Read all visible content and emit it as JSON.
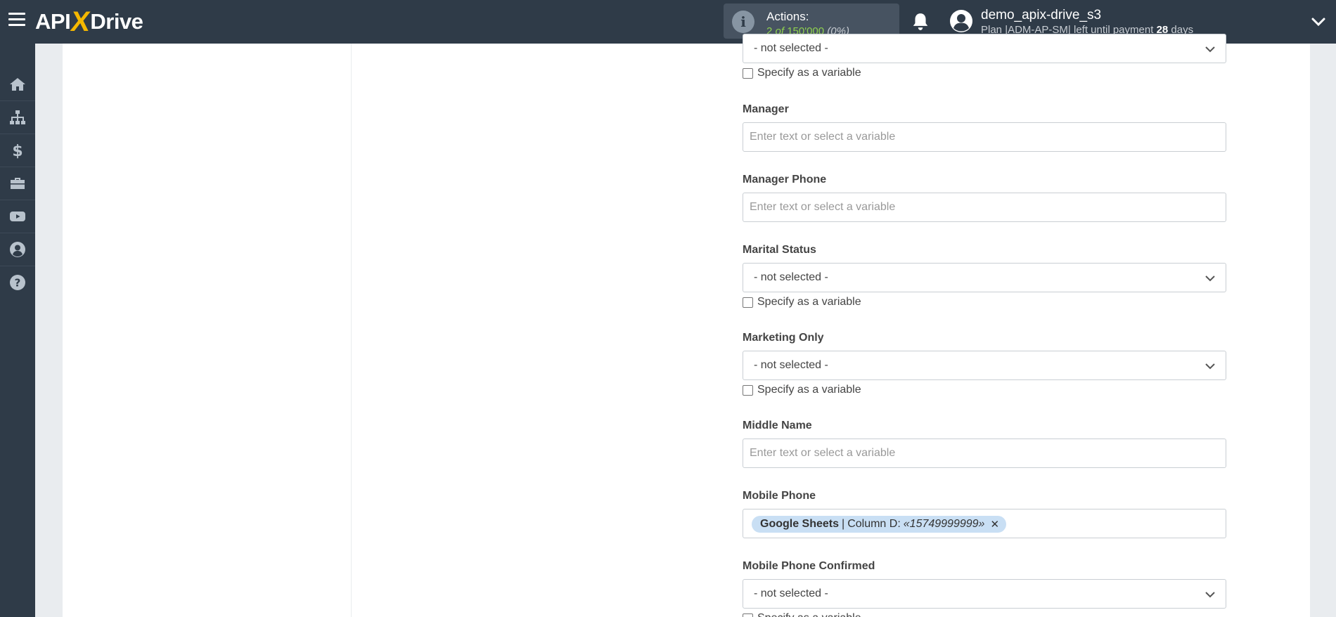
{
  "header": {
    "logo_left": "API",
    "logo_x": "X",
    "logo_right": "Drive",
    "actions_label": "Actions:",
    "actions_used": "2",
    "actions_of": "of",
    "actions_limit": "150'000",
    "actions_percent": "(0%)",
    "username": "demo_apix-drive_s3",
    "plan_prefix": "Plan |ADM-AP-SM| left until payment",
    "plan_days": "28",
    "plan_suffix": "days"
  },
  "sidebar": {
    "items": [
      {
        "icon": "home-icon"
      },
      {
        "icon": "sitemap-icon"
      },
      {
        "icon": "dollar-icon"
      },
      {
        "icon": "briefcase-icon"
      },
      {
        "icon": "youtube-icon"
      },
      {
        "icon": "user-circle-icon"
      },
      {
        "icon": "question-circle-icon"
      }
    ]
  },
  "form": {
    "top_select_value": "- not selected -",
    "specify_variable": "Specify as a variable",
    "input_placeholder": "Enter text or select a variable",
    "manager_label": "Manager",
    "manager_phone_label": "Manager Phone",
    "marital_status_label": "Marital Status",
    "marital_status_value": "- not selected -",
    "marketing_only_label": "Marketing Only",
    "marketing_only_value": "- not selected -",
    "middle_name_label": "Middle Name",
    "mobile_phone_label": "Mobile Phone",
    "mobile_phone_tag": {
      "source": "Google Sheets",
      "separator": "|",
      "column": "Column D:",
      "sample": "«15749999999»",
      "remove": "✕"
    },
    "mobile_phone_confirmed_label": "Mobile Phone Confirmed",
    "mobile_phone_confirmed_value": "- not selected -"
  },
  "colors": {
    "topbar": "#2f3b48",
    "accent_yellow": "#f5b800",
    "accent_green": "#8fd14f",
    "tag_bg": "#c9dff4"
  }
}
